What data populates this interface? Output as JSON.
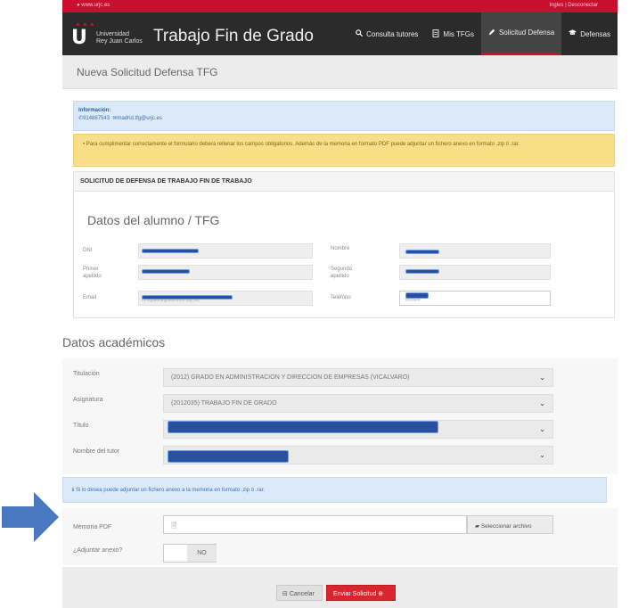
{
  "topbar": {
    "site": "www.urjc.es",
    "session": "Ingles | Desconectar"
  },
  "brand": {
    "line1": "Universidad",
    "line2": "Rey Juan Carlos",
    "app_title": "Trabajo Fin de Grado"
  },
  "nav": [
    {
      "label": "Consulta tutores",
      "icon": "search-icon"
    },
    {
      "label": "Mis TFGs",
      "icon": "document-icon"
    },
    {
      "label": "Solicitud Defensa",
      "icon": "pencil-icon",
      "active": true
    },
    {
      "label": "Defensas",
      "icon": "graduation-cap-icon"
    }
  ],
  "page_title": "Nueva Solicitud Defensa TFG",
  "info": {
    "heading": "Información:",
    "phone": "914887543",
    "email": "madrid.tfg@urjc.es"
  },
  "warning": "Para cumplimentar correctamente el formulario deberá rellenar los campos obligatorios. Además de la memoria en formato PDF puede adjuntar un fichero anexo en formato .zip ó .rar.",
  "card_header": "SOLICITUD DE DEFENSA DE TRABAJO FIN DE TRABAJO",
  "student": {
    "section_title": "Datos del alumno / TFG",
    "dni_label": "DNI",
    "nombre_label": "Nombre",
    "primer_label": "Primer apellido",
    "segundo_label": "Segundo apellido",
    "email_label": "Email",
    "telefono_label": "Teléfono",
    "email_value": "m.ingalana@alumnos.urjc.es",
    "telefono_value": "######"
  },
  "academic": {
    "section_title": "Datos académicos",
    "titulacion_label": "Titulación",
    "titulacion_value": "(2012) GRADO EN ADMINISTRACION Y DIRECCION DE EMPRESAS (VICALVARO)",
    "asignatura_label": "Asignatura",
    "asignatura_value": "(2012035) TRABAJO FIN DE GRADO",
    "titulo_label": "Título",
    "tutor_label": "Nombre del tutor"
  },
  "hint": "Si lo desea puede adjuntar un fichero anexo a la memoria en formato .zip ó .rar.",
  "memoria": {
    "label": "Memoria PDF",
    "button": "Seleccionar archivo",
    "anexo_label": "¿Adjuntar anexo?",
    "toggle_value": "NO"
  },
  "footer": {
    "cancel": "Cancelar",
    "send": "Enviar Solicitud"
  },
  "colors": {
    "brand_red": "#c8102e",
    "navbar": "#2b2b2b",
    "redaction": "#2a4f9e",
    "arrow": "#4a78c0"
  }
}
